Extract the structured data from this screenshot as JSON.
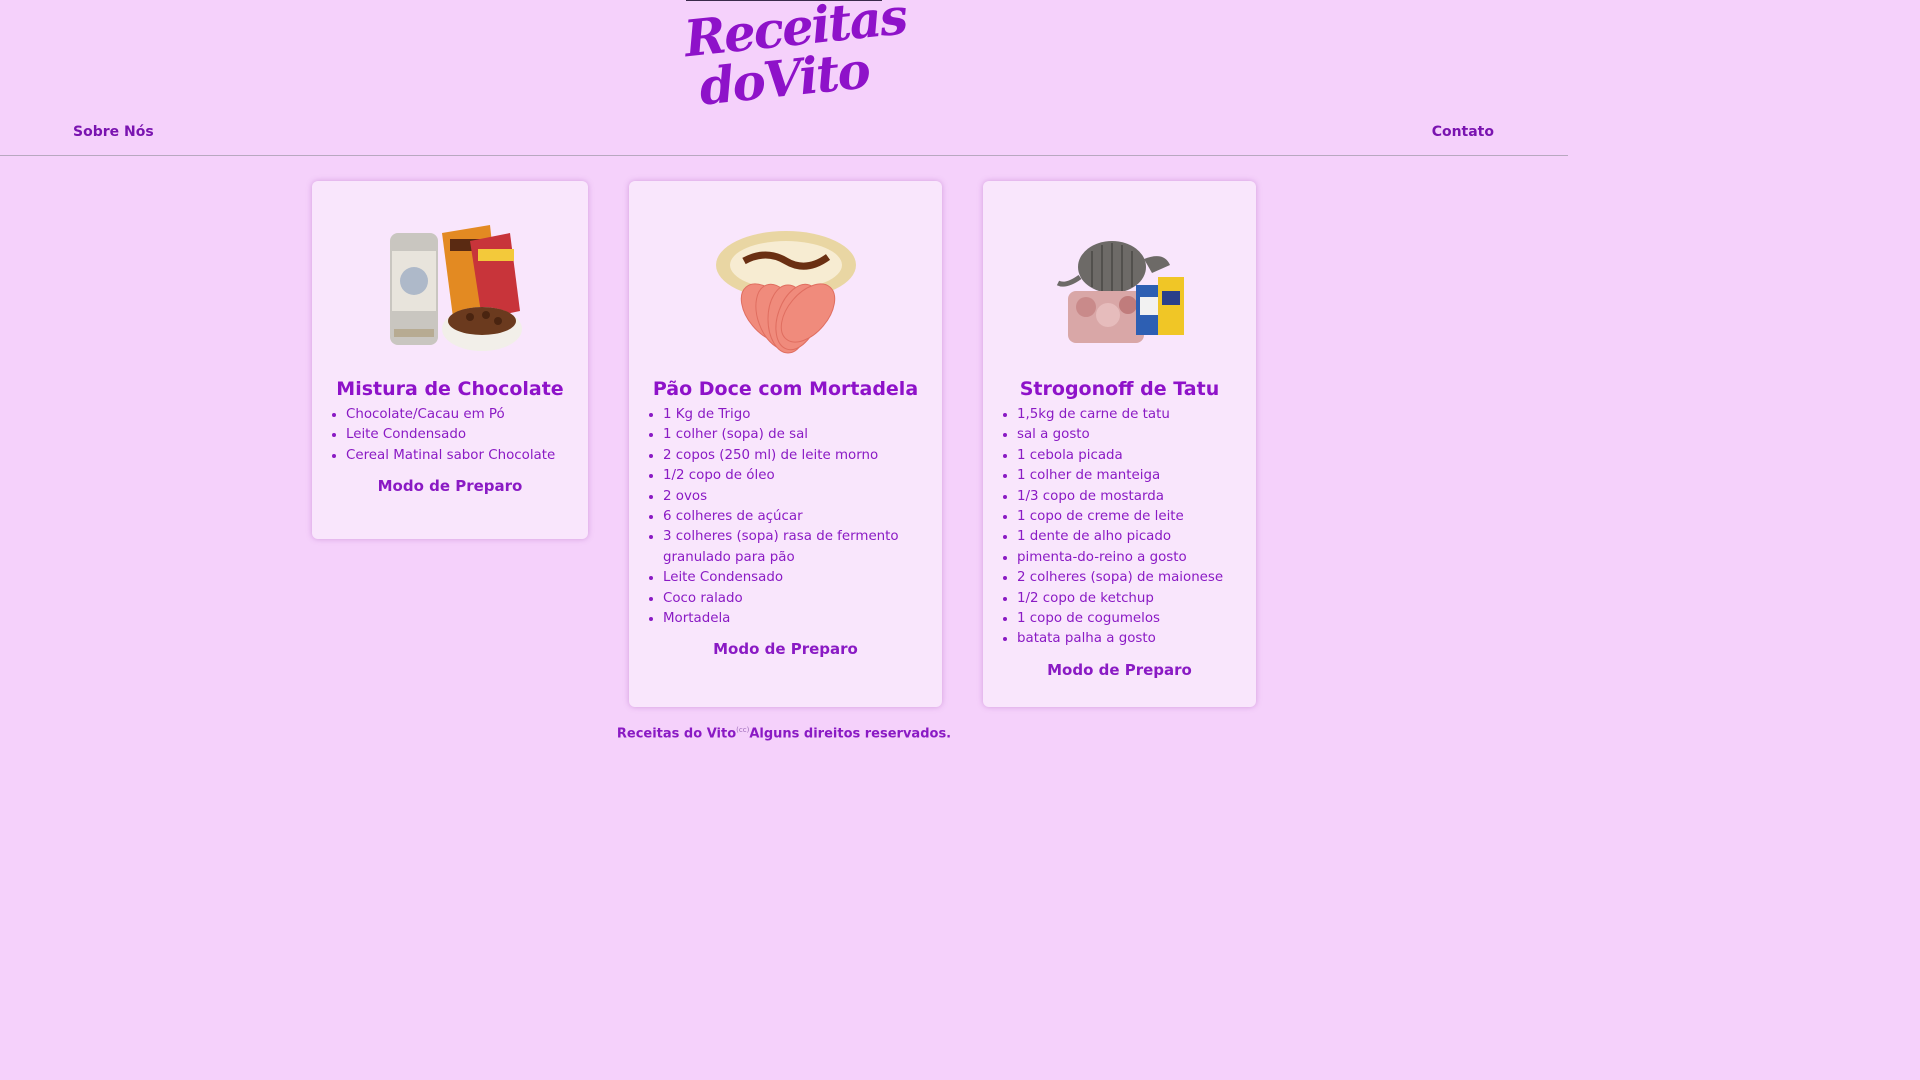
{
  "header": {
    "logo_line1": "Receitas",
    "logo_line2": "doVito",
    "nav_left": "Sobre Nós",
    "nav_right": "Contato"
  },
  "recipes": [
    {
      "title": "Mistura de Chocolate",
      "image": "chocolate-mix-photo",
      "ingredients": [
        "Chocolate/Cacau em Pó",
        "Leite Condensado",
        "Cereal Matinal sabor Chocolate"
      ],
      "prep_label": "Modo de Preparo"
    },
    {
      "title": "Pão Doce com Mortadela",
      "image": "sweet-bread-mortadella-photo",
      "ingredients": [
        "1 Kg de Trigo",
        "1 colher (sopa) de sal",
        "2 copos (250 ml) de leite morno",
        "1/2 copo de óleo",
        "2 ovos",
        "6 colheres de açúcar",
        "3 colheres (sopa) rasa de fermento granulado para pão",
        "Leite Condensado",
        "Coco ralado",
        "Mortadela"
      ],
      "prep_label": "Modo de Preparo"
    },
    {
      "title": "Strogonoff de Tatu",
      "image": "armadillo-strogonoff-photo",
      "ingredients": [
        "1,5kg de carne de tatu",
        "sal a gosto",
        "1 cebola picada",
        "1 colher de manteiga",
        "1/3 copo de mostarda",
        "1 copo de creme de leite",
        "1 dente de alho picado",
        "pimenta-do-reino a gosto",
        "2 colheres (sopa) de maionese",
        "1/2 copo de ketchup",
        "1 copo de cogumelos",
        "batata palha a gosto"
      ],
      "prep_label": "Modo de Preparo"
    }
  ],
  "footer": {
    "brand": "Receitas do Vito",
    "cc": "(cc)",
    "rights": "Alguns direitos reservados."
  },
  "colors": {
    "background": "#f5d1fb",
    "card": "#f9e6fc",
    "accent": "#8e12c9"
  }
}
